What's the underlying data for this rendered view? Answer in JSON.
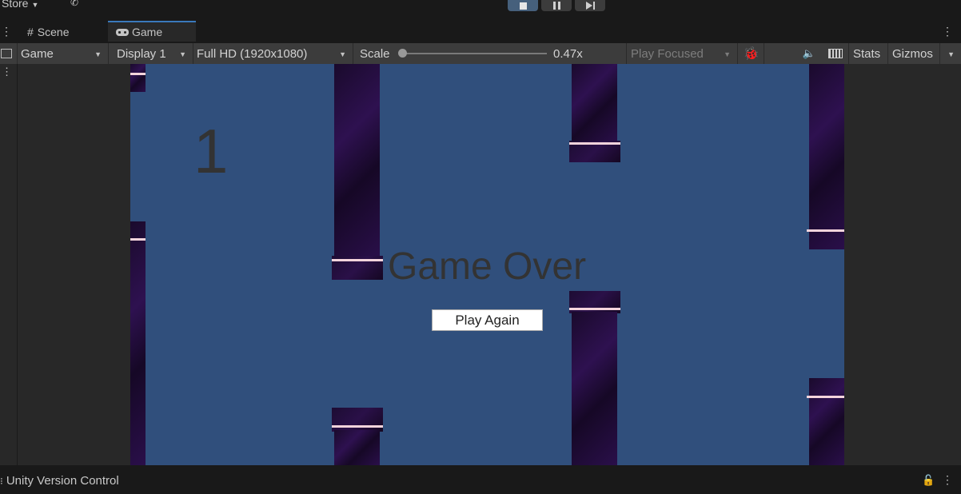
{
  "top": {
    "store_label": "Store",
    "controls": [
      {
        "name": "stop",
        "glyph": "■"
      },
      {
        "name": "pause",
        "glyph": "❚❚"
      },
      {
        "name": "step",
        "glyph": "▶❚"
      }
    ]
  },
  "tabs": {
    "scene": "Scene",
    "game": "Game"
  },
  "toolbar": {
    "view": "Game",
    "display": "Display 1",
    "resolution": "Full HD (1920x1080)",
    "scale_label": "Scale",
    "scale_value": "0.47x",
    "play_mode": "Play Focused",
    "stats": "Stats",
    "gizmos": "Gizmos"
  },
  "game": {
    "score": "1",
    "game_over": "Game Over",
    "play_again": "Play Again"
  },
  "footer": {
    "title": "Unity Version Control"
  },
  "colors": {
    "game_background": "#304f7c",
    "pipe": "#1f0b35",
    "pipe_highlight": "#f4d4dc"
  }
}
